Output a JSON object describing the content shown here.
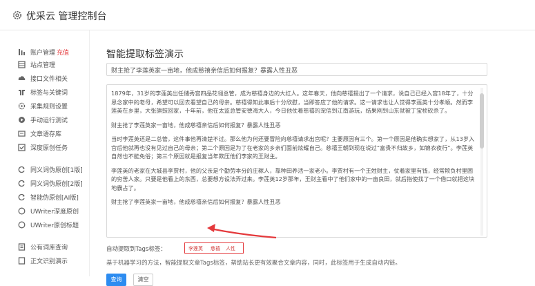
{
  "app": {
    "title": "优采云 管理控制台"
  },
  "sidebar": {
    "items": [
      {
        "label": "账户管理",
        "badge": "充值",
        "icon": "user-icon"
      },
      {
        "label": "站点管理",
        "icon": "list-icon"
      },
      {
        "label": "接口文件相关",
        "icon": "cloud-icon"
      },
      {
        "label": "标签与关键词",
        "icon": "tag-icon"
      },
      {
        "label": "采集规则设置",
        "icon": "gear-icon"
      },
      {
        "label": "手动运行测试",
        "icon": "play-icon"
      },
      {
        "label": "文章语存库",
        "icon": "folder-icon"
      },
      {
        "label": "深度原创任务",
        "icon": "check-icon"
      },
      {
        "label": "同义词伪原创[1版]",
        "icon": "refresh-icon"
      },
      {
        "label": "同义词伪原创[2版]",
        "icon": "refresh-icon"
      },
      {
        "label": "智能伪原创[AI版]",
        "icon": "refresh-icon"
      },
      {
        "label": "UWriter深度原创",
        "icon": "circle-icon"
      },
      {
        "label": "UWriter原创标题",
        "icon": "circle-icon"
      },
      {
        "label": "公有词库查询",
        "icon": "book-icon"
      },
      {
        "label": "正文识别演示",
        "icon": "doc-icon"
      }
    ]
  },
  "main": {
    "page_title": "智能提取标签演示",
    "title_input_value": "财主抢了李莲英家一亩地，他成慈禧亲信后如何报复？暴露人性丑恶",
    "content_paragraphs": [
      "1879年，31岁的李莲英出任储秀宫四品花翎总管，成为慈禧身边的大红人。这年春天，他向慈禧提出了一个请求，说自己已经入宫18年了，十分思念家中的老母，希望可以回去看望自己的母亲。慈禧得知此事后十分欣慰，当即答应了他的请求。这一请求也让人觉得李莲英十分孝顺。然而李莲英在乡里，大张旗鼓回家，十年前，他在太监总管安德海大人，今日他仗着慈禧的宠信到江南游玩，结果刚到山东就被丁宝桢砍杀了。",
      "财主抢了李莲英家一亩地，他成慈禧亲信后如何报复？暴露人性丑恶",
      "当时李莲英还是二总管，这件事他再清楚不过。那么他为何还要冒险向慈禧请求出宫呢？主要原因有三个。第一个原因是他确实想家了，从13岁入宫后他就再也没有见过自己的母亲；第二个原因是为了在老家的乡亲们面前炫耀自己。慈禧王朝到现在说过“富贵不归故乡，如锦衣夜行”。李莲英自然也不能免俗；第三个原因就是报复当年欺压他们李家的王财主。",
      "李莲英的老家在大城县李贾村，他的父亲是个勤劳本分的庄稼人，靠种田养活一家老小。李贾村有一个王姓财主，仗着家里有钱，经常欺负村里困的穷苦人家。只要是他看上的东西，总要想方设法弄过来。李莲英12岁那年，王财主看中了他们家中的一亩良田，就后指使找了一个借口就把这块地霸占了。",
      "财主抢了李莲英家一亩地，他成慈禧亲信后如何报复？暴露人性丑恶"
    ],
    "tags_label": "自动提取到Tags标签：",
    "tags": [
      "李莲英",
      "慈禧",
      "人性"
    ],
    "help_text": "基于机器学习的方法，智能提取文章Tags标签，帮助站长更有效聚合文章内容，同时，此标签用于生成自动内链。",
    "query_button": "查询",
    "clear_button": "清空"
  },
  "colors": {
    "accent": "#2d8cf0",
    "highlight": "#e4393c"
  }
}
